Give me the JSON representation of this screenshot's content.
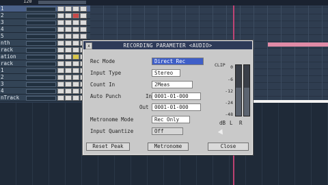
{
  "top": {
    "value": "120"
  },
  "tracks": [
    {
      "label": "1",
      "selected": true
    },
    {
      "label": "2"
    },
    {
      "label": "3"
    },
    {
      "label": "4"
    },
    {
      "label": "5"
    },
    {
      "label": "nth"
    },
    {
      "label": "rack"
    },
    {
      "label": "ation"
    },
    {
      "label": "rack"
    },
    {
      "label": "1"
    },
    {
      "label": "2"
    },
    {
      "label": "3"
    },
    {
      "label": "4"
    },
    {
      "label": "nTrack"
    }
  ],
  "dialog": {
    "title": "RECORDING PARAMETER <AUDIO>",
    "close_x": "x",
    "rec_mode_label": "Rec Mode",
    "rec_mode_value": "Direct Rec",
    "input_type_label": "Input Type",
    "input_type_value": "Stereo",
    "count_in_label": "Count In",
    "count_in_value": "2Meas",
    "auto_punch_label": "Auto Punch",
    "in_label": "In",
    "in_value": "0001-01-000",
    "out_label": "Out",
    "out_value": "0001-01-000",
    "metronome_mode_label": "Metronome Mode",
    "metronome_mode_value": "Rec Only",
    "input_quantize_label": "Input Quantize",
    "input_quantize_value": "Off",
    "meter_clip": "CLIP",
    "meter_scale": [
      "0",
      "-6",
      "-12",
      "-24",
      "-48"
    ],
    "meter_db": "dB",
    "meter_l": "L",
    "meter_r": "R",
    "meter_level_left": 0.55,
    "meter_level_right": 0.55,
    "reset_peak_label": "Reset Peak",
    "metronome_label": "Metronome",
    "close_label": "Close"
  }
}
